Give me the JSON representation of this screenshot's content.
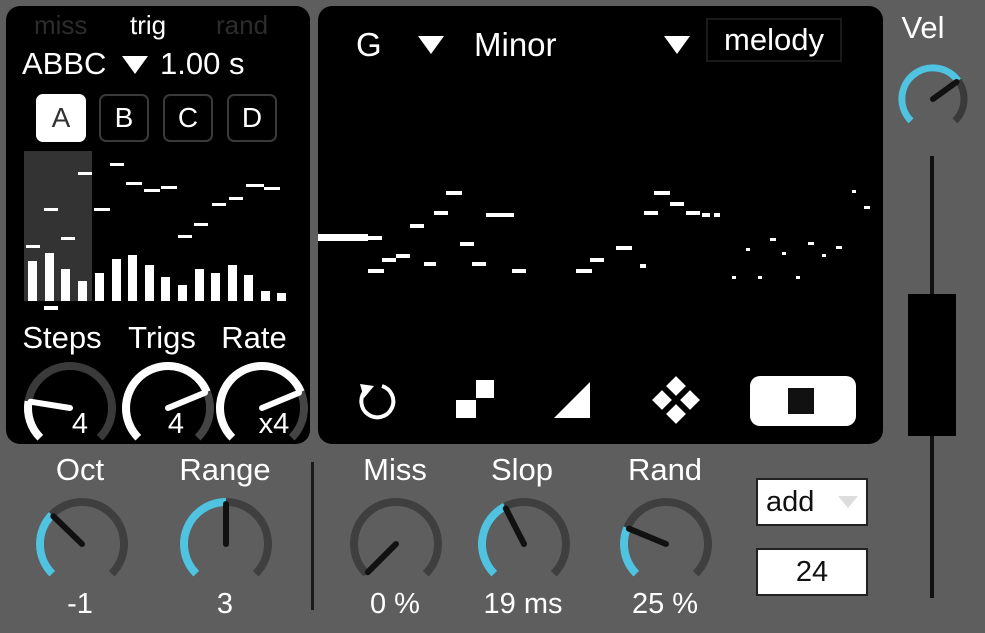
{
  "colors": {
    "device_bg": "#5e5e5e",
    "panel_bg": "#000000",
    "accent": "#4fc3e0",
    "knob_track": "#3f3f3f",
    "text": "#ffffff"
  },
  "left_panel": {
    "mode_tabs": [
      "miss",
      "trig",
      "rand"
    ],
    "active_mode": "trig",
    "pattern": "ABBC",
    "pattern_dropdown_icon": "triangle-down-icon",
    "length": "1.00 s",
    "pattern_buttons": [
      "A",
      "B",
      "C",
      "D"
    ],
    "active_pattern": "A",
    "knobs": [
      {
        "label": "Steps",
        "value": "4",
        "level": 0.2
      },
      {
        "label": "Trigs",
        "value": "4",
        "level": 0.75
      },
      {
        "label": "Rate",
        "value": "x4",
        "level": 0.75
      }
    ]
  },
  "center_panel": {
    "root": "G",
    "scale": "Minor",
    "preset": "melody",
    "tools": [
      "rotate-icon",
      "checker-icon",
      "ramp-icon",
      "diamond-grid-icon",
      "stop-icon"
    ]
  },
  "right_panel": {
    "label": "Vel",
    "level": 0.7
  },
  "bottom": {
    "knobs": [
      {
        "label": "Oct",
        "value": "-1",
        "level": 0.33
      },
      {
        "label": "Range",
        "value": "3",
        "level": 0.5
      },
      {
        "label": "Miss",
        "value": "0 %",
        "level": 0.0
      },
      {
        "label": "Slop",
        "value": "19 ms",
        "level": 0.4
      },
      {
        "label": "Rand",
        "value": "25 %",
        "level": 0.25
      }
    ],
    "mode_select": "add",
    "number": "24"
  }
}
